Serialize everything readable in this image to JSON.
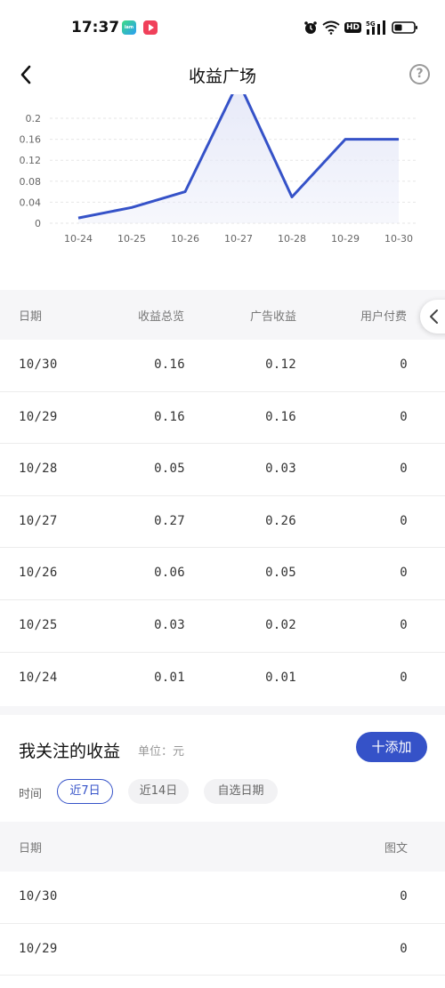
{
  "status_bar": {
    "time": "17:37",
    "app1_label": "iam",
    "hd": "HD",
    "signal": "5G"
  },
  "nav": {
    "title": "收益广场",
    "help": "?"
  },
  "chart_data": {
    "type": "area",
    "categories": [
      "10-24",
      "10-25",
      "10-26",
      "10-27",
      "10-28",
      "10-29",
      "10-30"
    ],
    "values": [
      0.01,
      0.03,
      0.06,
      0.27,
      0.05,
      0.16,
      0.16
    ],
    "yticks": [
      "0",
      "0.04",
      "0.08",
      "0.12",
      "0.16",
      "0.2"
    ],
    "ylim": [
      0,
      0.2
    ],
    "line_color": "#3552c8",
    "fill_color": "#e6e9f8",
    "grid": true
  },
  "summary_table": {
    "headers": [
      "日期",
      "收益总览",
      "广告收益",
      "用户付费"
    ],
    "rows": [
      [
        "10/30",
        "0.16",
        "0.12",
        "0"
      ],
      [
        "10/29",
        "0.16",
        "0.16",
        "0"
      ],
      [
        "10/28",
        "0.05",
        "0.03",
        "0"
      ],
      [
        "10/27",
        "0.27",
        "0.26",
        "0"
      ],
      [
        "10/26",
        "0.06",
        "0.05",
        "0"
      ],
      [
        "10/25",
        "0.03",
        "0.02",
        "0"
      ],
      [
        "10/24",
        "0.01",
        "0.01",
        "0"
      ]
    ]
  },
  "follow": {
    "title": "我关注的收益",
    "unit": "单位：元",
    "add_button": "十添加",
    "time_label": "时间",
    "chips": [
      "近7日",
      "近14日",
      "自选日期"
    ],
    "headers": [
      "日期",
      "图文"
    ],
    "rows": [
      [
        "10/30",
        "0"
      ],
      [
        "10/29",
        "0"
      ]
    ]
  },
  "colors": {
    "accent": "#3552c8",
    "header_bg": "#f6f6f8"
  }
}
